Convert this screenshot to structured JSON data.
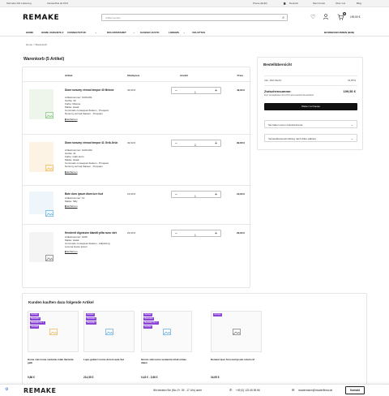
{
  "topbar": {
    "shipping": "Schnelle 24h Lieferung",
    "free_shipping": "Versandfrei ab 50 €",
    "currency": "Preise (EUR)",
    "language": "Deutsch",
    "register": "Mein Konto",
    "about": "Über uns",
    "blog": "Blog"
  },
  "header": {
    "logo": "REMAKE",
    "search_placeholder": "Artikel suchen",
    "cart_count": "1",
    "cart_total": "199,50 €"
  },
  "nav": {
    "items": [
      "HOME",
      "HOME VARIANTE 2",
      "CONSECTETUR",
      "DOLORSITAMET",
      "KASKED JUSTO",
      "LOREMS",
      "VOLUPTAS"
    ],
    "right": "BUSINESSKUNDEN (B2B)"
  },
  "breadcrumb": "Home > Warenkorb",
  "cart": {
    "title": "Warenkorb (5 Artikel)",
    "columns": {
      "product": "Artikel",
      "unit": "Stückpreis",
      "qty": "Anzahl",
      "price": "Preis"
    },
    "remove_label": "Entfernen",
    "items": [
      {
        "name": "Diam nonumy eirmod tempor 40 Melone",
        "details": [
          "Artikelnummer: 1020-001",
          "Größe: 40",
          "Farbe: Melone",
          "Marke: Hawk",
          "Commodo consequat Zautem , Proquam",
          "Nonumy eirmod Zautem , Proquam"
        ],
        "unit_price": "49,90 €",
        "qty": "1",
        "total": "49,90 €",
        "thumb_color": "#eef6ec",
        "icon_color": "#7fc07a"
      },
      {
        "name": "Diam nonumy eirmod tempor 41 Gelb-Grün",
        "details": [
          "Artikelnummer: 1020-002",
          "Größe: 41",
          "Farbe: Gelb-Grün",
          "Marke: Hawk",
          "Commodo consequat Zautem , Proquam",
          "Nonumy eirmod Zautem , Proquam"
        ],
        "unit_price": "49,90 €",
        "qty": "2",
        "total": "99,80 €",
        "thumb_color": "#fdf3e4",
        "icon_color": "#f0b650"
      },
      {
        "name": "Bote duro ipsum diam iure fust",
        "details": [
          "Artikelnummer: 12",
          "Marke: Silly"
        ],
        "unit_price": "19,90 €",
        "qty": "1",
        "total": "19,90 €",
        "thumb_color": "#eef6fc",
        "icon_color": "#5aa9e0"
      },
      {
        "name": "Hendrerit dignissim blandit pilta nunc stet",
        "details": [
          "Artikelnummer: 1025",
          "Marke: Hawk",
          "Commodo consequat Zautem , Adipiscing",
          "Lorema Gusto ipsum"
        ],
        "unit_price": "29,90 €",
        "qty": "1",
        "total": "29,90 €",
        "thumb_color": "#f4f4f4",
        "icon_color": "#777777"
      }
    ]
  },
  "summary": {
    "title": "Bestellübersicht",
    "vat_label": "Inkl. 19% MwSt.:",
    "vat_value": "31,85 €",
    "subtotal_label": "Zwischensumme:",
    "subtotal_value": "199,50 €",
    "subtotal_note": "Zzgl. Versandkosten ab 0,00 € nach Lieferland Deutschland",
    "checkout_button": "Weiter zur Kasse",
    "coupon_label": "Sie haben einen Gutscheincode",
    "shipping_calc_label": "Versandkostenermittlung nach (bitte wählen)"
  },
  "recommendations": {
    "title": "Kunden kauften dazu folgende Artikel",
    "items": [
      {
        "name": "Home stet nome veniamu miak Varianté gelb",
        "price": "9,86 €",
        "badges": [
          "Neuheit",
          "Bestseller",
          "Bestseller Nr. 1",
          "Versand"
        ],
        "icon_color": "#f0b650"
      },
      {
        "name": "Lupo guberri nomo dorem aute Set",
        "price": "214,55 €",
        "badges": [
          "Neuheit",
          "Bestseller",
          "Bestseller"
        ],
        "icon_color": "#5aa9e0"
      },
      {
        "name": "Hunno stät nomo venianmi ntiuk eimao diaim",
        "price": "0,43 € - 0,58 €",
        "badges": [
          "Neuheit",
          "Bestseller",
          "Bestseller Nr. 1",
          "Neuheit"
        ],
        "icon_color": "#5aa9e0"
      },
      {
        "name": "Dement ipsu forn mal ipsum retum ref",
        "price": "34,95 €",
        "badges": [
          "Neuheit"
        ],
        "icon_color": "#777777"
      }
    ]
  },
  "footer": {
    "logo": "REMAKE",
    "hours": "Wir beraten Sie (Mo.-Fr. 09 - 17 Uhr) unter",
    "phone": "+49 (0) 123 45 55 66",
    "email": "mustermann@musterfirma.de",
    "contact_button": "Kontakt"
  }
}
